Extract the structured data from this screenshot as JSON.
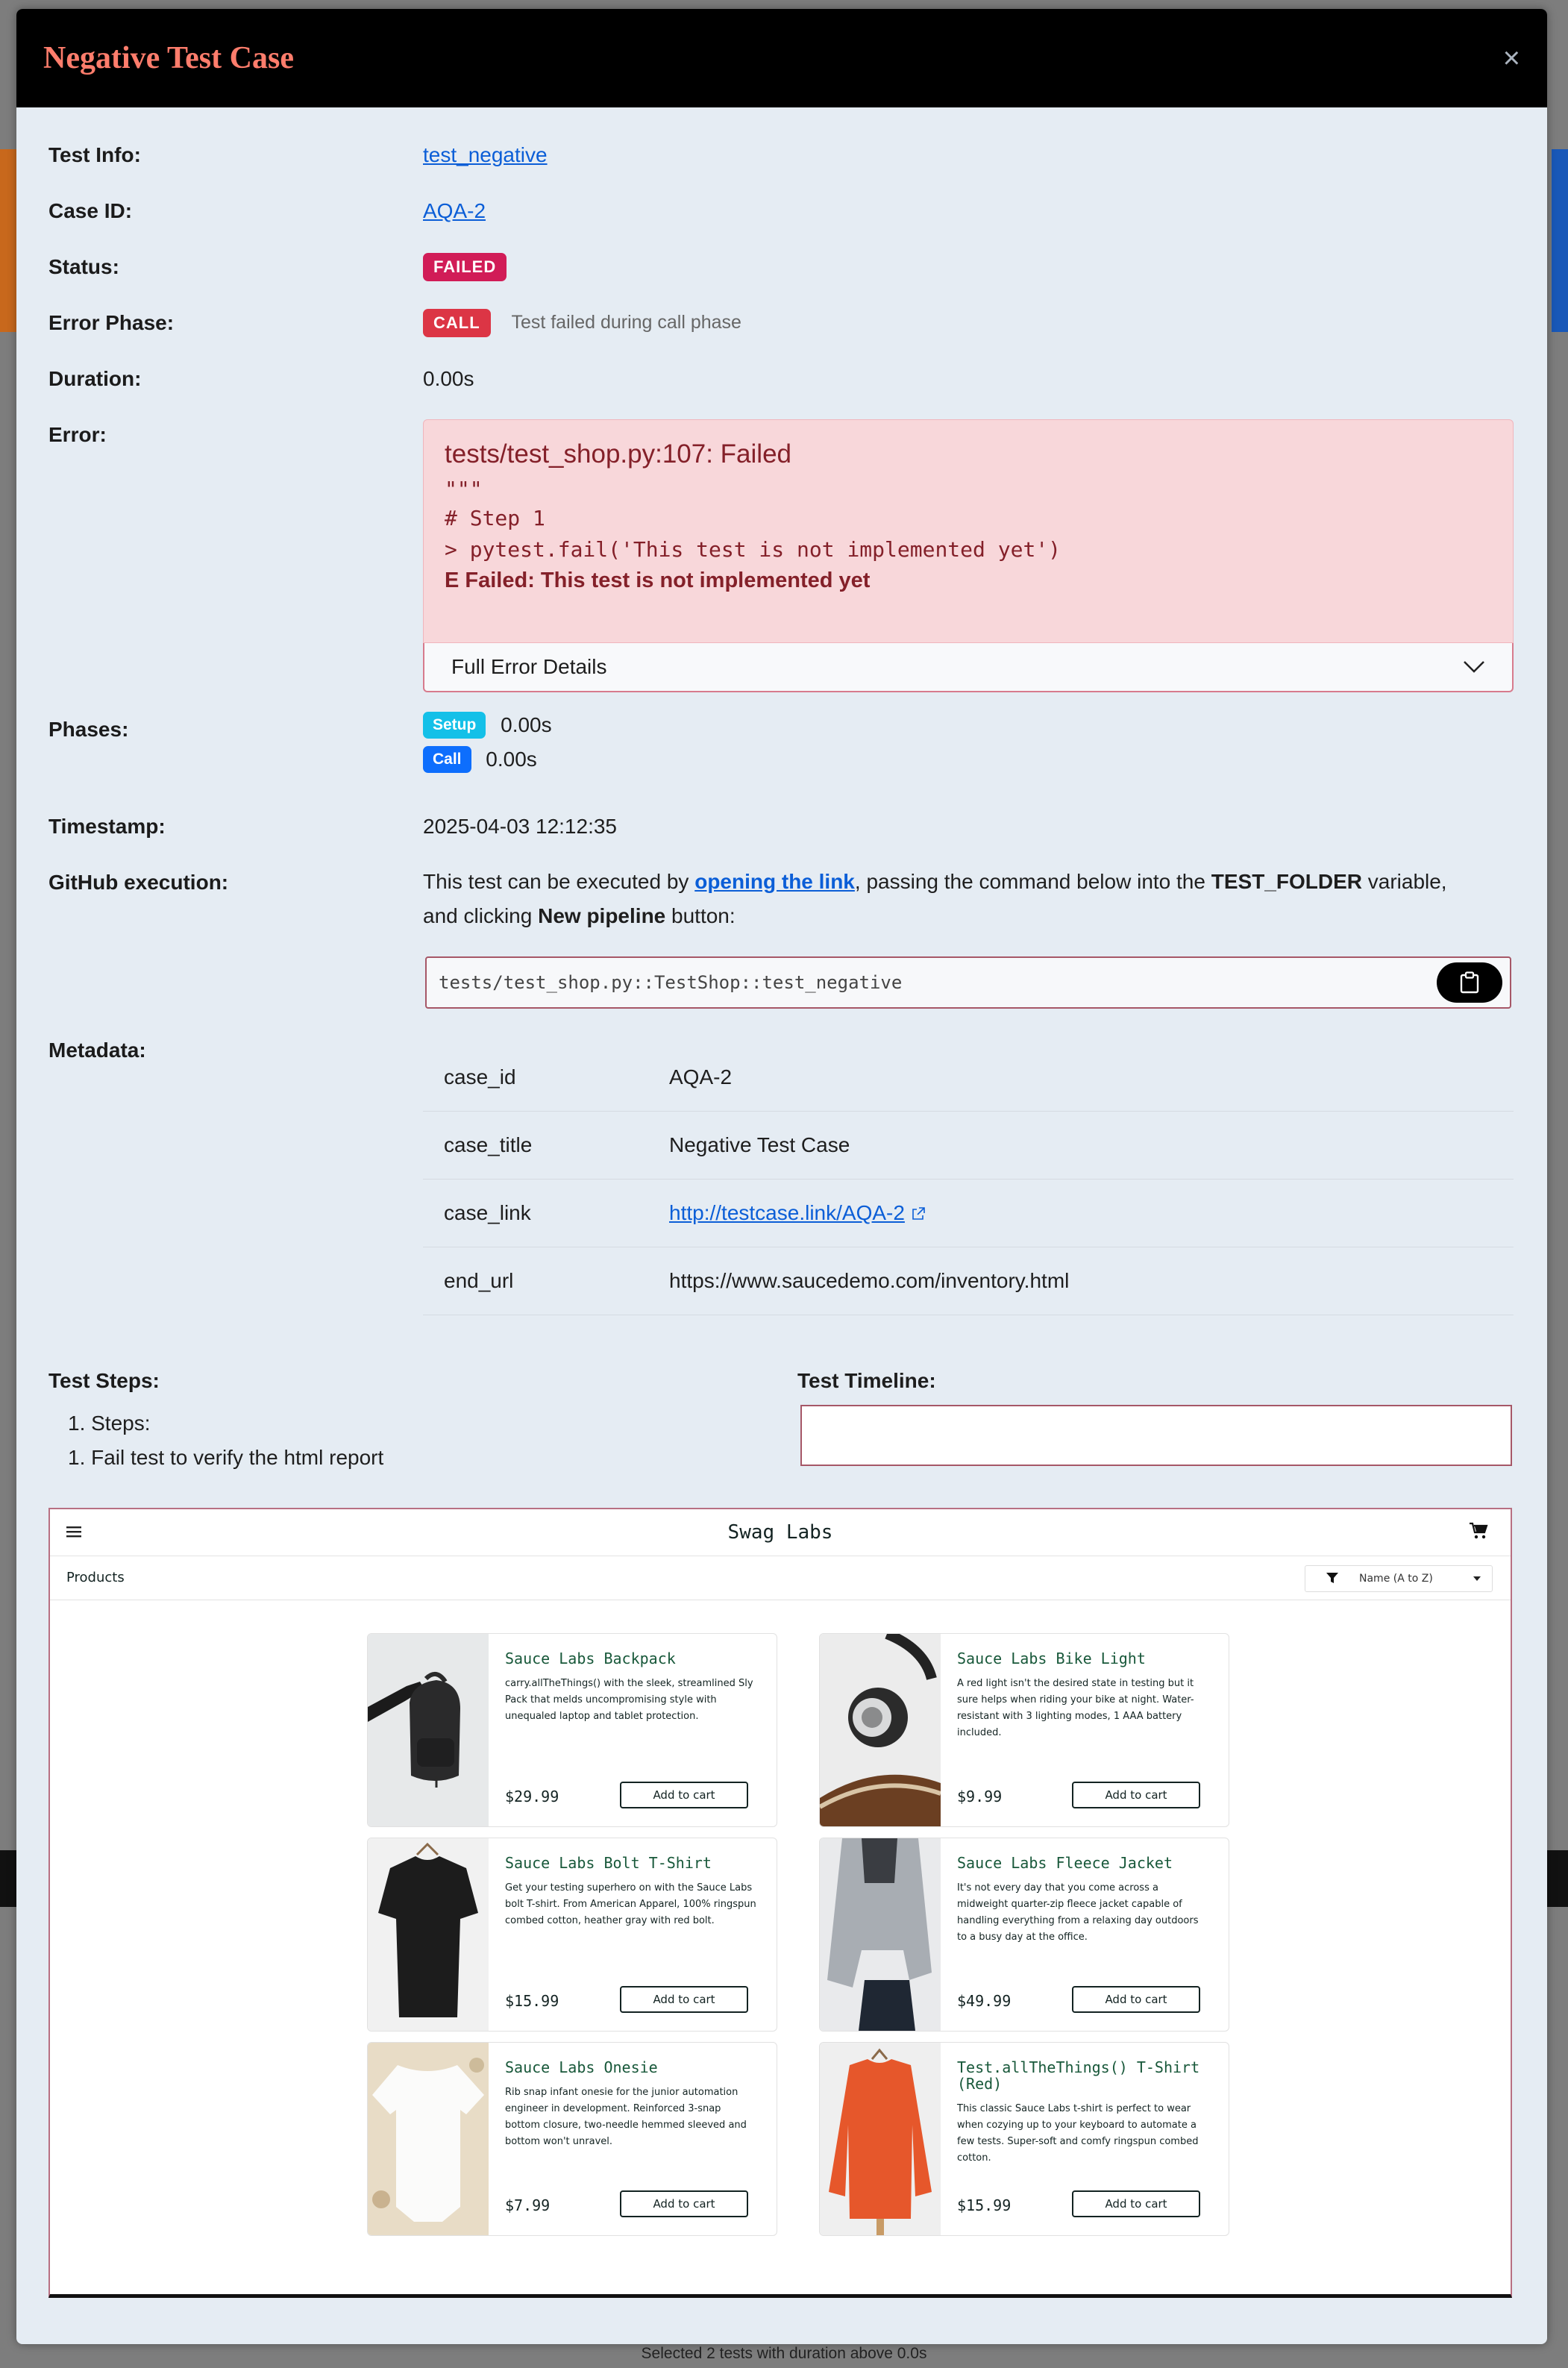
{
  "modal": {
    "title": "Negative Test Case",
    "close": "×"
  },
  "fields": {
    "test_info_label": "Test Info:",
    "test_info_value": "test_negative",
    "case_id_label": "Case ID:",
    "case_id_value": "AQA-2",
    "status_label": "Status:",
    "status_value": "FAILED",
    "error_phase_label": "Error Phase:",
    "error_phase_badge": "CALL",
    "error_phase_text": "Test failed during call phase",
    "duration_label": "Duration:",
    "duration_value": "0.00s",
    "error_label": "Error:",
    "phases_label": "Phases:",
    "timestamp_label": "Timestamp:",
    "timestamp_value": "2025-04-03 12:12:35",
    "github_label": "GitHub execution:",
    "metadata_label": "Metadata:"
  },
  "error": {
    "title": "tests/test_shop.py:107: Failed",
    "quote": "\"\"\"",
    "lines": [
      "# Step 1",
      "> pytest.fail('This test is not implemented yet')"
    ],
    "final": "E Failed: This test is not implemented yet",
    "details_label": "Full Error Details"
  },
  "phases": [
    {
      "name": "Setup",
      "time": "0.00s",
      "color": "#14c0e8"
    },
    {
      "name": "Call",
      "time": "0.00s",
      "color": "#0d6efd"
    }
  ],
  "github": {
    "text1": "This test can be executed by ",
    "link": "opening the link",
    "text2": ", passing the command below into the ",
    "var": "TEST_FOLDER",
    "text3": " variable,",
    "text4": "and clicking ",
    "button": "New pipeline",
    "text5": " button:",
    "command": "tests/test_shop.py::TestShop::test_negative"
  },
  "metadata": [
    {
      "key": "case_id",
      "value": "AQA-2"
    },
    {
      "key": "case_title",
      "value": "Negative Test Case"
    },
    {
      "key": "case_link",
      "value": "http://testcase.link/AQA-2"
    },
    {
      "key": "end_url",
      "value": "https://www.saucedemo.com/inventory.html"
    }
  ],
  "steps": {
    "label": "Test Steps:",
    "items": [
      "1. Steps:",
      "1. Fail test to verify the html report"
    ]
  },
  "timeline": {
    "label": "Test Timeline:"
  },
  "app": {
    "brand": "Swag Labs",
    "products_label": "Products",
    "sort_value": "Name (A to Z)",
    "add_label": "Add to cart",
    "items": [
      {
        "name": "Sauce Labs Backpack",
        "desc": "carry.allTheThings() with the sleek, streamlined Sly Pack that melds uncompromising style with unequaled laptop and tablet protection.",
        "price": "$29.99"
      },
      {
        "name": "Sauce Labs Bike Light",
        "desc": "A red light isn't the desired state in testing but it sure helps when riding your bike at night. Water-resistant with 3 lighting modes, 1 AAA battery included.",
        "price": "$9.99"
      },
      {
        "name": "Sauce Labs Bolt T-Shirt",
        "desc": "Get your testing superhero on with the Sauce Labs bolt T-shirt. From American Apparel, 100% ringspun combed cotton, heather gray with red bolt.",
        "price": "$15.99"
      },
      {
        "name": "Sauce Labs Fleece Jacket",
        "desc": "It's not every day that you come across a midweight quarter-zip fleece jacket capable of handling everything from a relaxing day outdoors to a busy day at the office.",
        "price": "$49.99"
      },
      {
        "name": "Sauce Labs Onesie",
        "desc": "Rib snap infant onesie for the junior automation engineer in development. Reinforced 3-snap bottom closure, two-needle hemmed sleeved and bottom won't unravel.",
        "price": "$7.99"
      },
      {
        "name": "Test.allTheThings() T-Shirt (Red)",
        "desc": "This classic Sauce Labs t-shirt is perfect to wear when cozying up to your keyboard to automate a few tests. Super-soft and comfy ringspun combed cotton.",
        "price": "$15.99"
      }
    ]
  },
  "footer": {
    "status": "Selected 2 tests with duration above 0.0s"
  },
  "colors": {
    "header_bg": "#000000",
    "title": "#ff7d6c",
    "failed": "#d11c57",
    "call": "#dc3545",
    "link": "#0b5ed7"
  }
}
